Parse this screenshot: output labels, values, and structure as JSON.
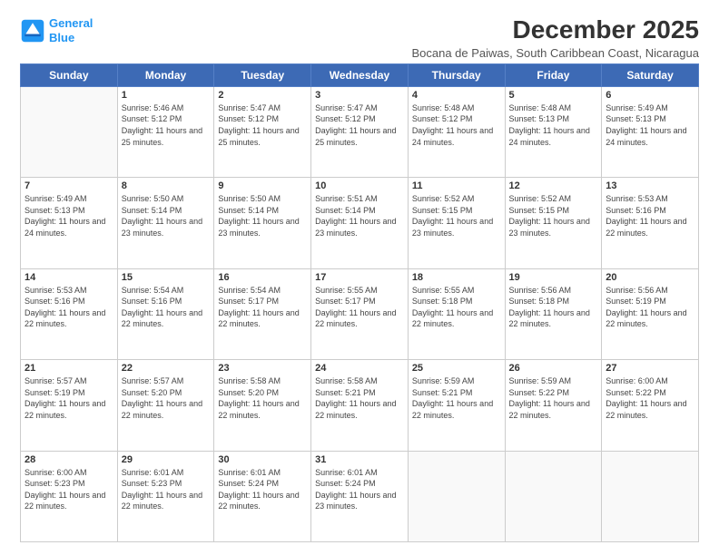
{
  "header": {
    "logo_line1": "General",
    "logo_line2": "Blue",
    "main_title": "December 2025",
    "subtitle": "Bocana de Paiwas, South Caribbean Coast, Nicaragua"
  },
  "weekdays": [
    "Sunday",
    "Monday",
    "Tuesday",
    "Wednesday",
    "Thursday",
    "Friday",
    "Saturday"
  ],
  "weeks": [
    [
      {
        "day": "",
        "sunrise": "",
        "sunset": "",
        "daylight": ""
      },
      {
        "day": "1",
        "sunrise": "Sunrise: 5:46 AM",
        "sunset": "Sunset: 5:12 PM",
        "daylight": "Daylight: 11 hours and 25 minutes."
      },
      {
        "day": "2",
        "sunrise": "Sunrise: 5:47 AM",
        "sunset": "Sunset: 5:12 PM",
        "daylight": "Daylight: 11 hours and 25 minutes."
      },
      {
        "day": "3",
        "sunrise": "Sunrise: 5:47 AM",
        "sunset": "Sunset: 5:12 PM",
        "daylight": "Daylight: 11 hours and 25 minutes."
      },
      {
        "day": "4",
        "sunrise": "Sunrise: 5:48 AM",
        "sunset": "Sunset: 5:12 PM",
        "daylight": "Daylight: 11 hours and 24 minutes."
      },
      {
        "day": "5",
        "sunrise": "Sunrise: 5:48 AM",
        "sunset": "Sunset: 5:13 PM",
        "daylight": "Daylight: 11 hours and 24 minutes."
      },
      {
        "day": "6",
        "sunrise": "Sunrise: 5:49 AM",
        "sunset": "Sunset: 5:13 PM",
        "daylight": "Daylight: 11 hours and 24 minutes."
      }
    ],
    [
      {
        "day": "7",
        "sunrise": "Sunrise: 5:49 AM",
        "sunset": "Sunset: 5:13 PM",
        "daylight": "Daylight: 11 hours and 24 minutes."
      },
      {
        "day": "8",
        "sunrise": "Sunrise: 5:50 AM",
        "sunset": "Sunset: 5:14 PM",
        "daylight": "Daylight: 11 hours and 23 minutes."
      },
      {
        "day": "9",
        "sunrise": "Sunrise: 5:50 AM",
        "sunset": "Sunset: 5:14 PM",
        "daylight": "Daylight: 11 hours and 23 minutes."
      },
      {
        "day": "10",
        "sunrise": "Sunrise: 5:51 AM",
        "sunset": "Sunset: 5:14 PM",
        "daylight": "Daylight: 11 hours and 23 minutes."
      },
      {
        "day": "11",
        "sunrise": "Sunrise: 5:52 AM",
        "sunset": "Sunset: 5:15 PM",
        "daylight": "Daylight: 11 hours and 23 minutes."
      },
      {
        "day": "12",
        "sunrise": "Sunrise: 5:52 AM",
        "sunset": "Sunset: 5:15 PM",
        "daylight": "Daylight: 11 hours and 23 minutes."
      },
      {
        "day": "13",
        "sunrise": "Sunrise: 5:53 AM",
        "sunset": "Sunset: 5:16 PM",
        "daylight": "Daylight: 11 hours and 22 minutes."
      }
    ],
    [
      {
        "day": "14",
        "sunrise": "Sunrise: 5:53 AM",
        "sunset": "Sunset: 5:16 PM",
        "daylight": "Daylight: 11 hours and 22 minutes."
      },
      {
        "day": "15",
        "sunrise": "Sunrise: 5:54 AM",
        "sunset": "Sunset: 5:16 PM",
        "daylight": "Daylight: 11 hours and 22 minutes."
      },
      {
        "day": "16",
        "sunrise": "Sunrise: 5:54 AM",
        "sunset": "Sunset: 5:17 PM",
        "daylight": "Daylight: 11 hours and 22 minutes."
      },
      {
        "day": "17",
        "sunrise": "Sunrise: 5:55 AM",
        "sunset": "Sunset: 5:17 PM",
        "daylight": "Daylight: 11 hours and 22 minutes."
      },
      {
        "day": "18",
        "sunrise": "Sunrise: 5:55 AM",
        "sunset": "Sunset: 5:18 PM",
        "daylight": "Daylight: 11 hours and 22 minutes."
      },
      {
        "day": "19",
        "sunrise": "Sunrise: 5:56 AM",
        "sunset": "Sunset: 5:18 PM",
        "daylight": "Daylight: 11 hours and 22 minutes."
      },
      {
        "day": "20",
        "sunrise": "Sunrise: 5:56 AM",
        "sunset": "Sunset: 5:19 PM",
        "daylight": "Daylight: 11 hours and 22 minutes."
      }
    ],
    [
      {
        "day": "21",
        "sunrise": "Sunrise: 5:57 AM",
        "sunset": "Sunset: 5:19 PM",
        "daylight": "Daylight: 11 hours and 22 minutes."
      },
      {
        "day": "22",
        "sunrise": "Sunrise: 5:57 AM",
        "sunset": "Sunset: 5:20 PM",
        "daylight": "Daylight: 11 hours and 22 minutes."
      },
      {
        "day": "23",
        "sunrise": "Sunrise: 5:58 AM",
        "sunset": "Sunset: 5:20 PM",
        "daylight": "Daylight: 11 hours and 22 minutes."
      },
      {
        "day": "24",
        "sunrise": "Sunrise: 5:58 AM",
        "sunset": "Sunset: 5:21 PM",
        "daylight": "Daylight: 11 hours and 22 minutes."
      },
      {
        "day": "25",
        "sunrise": "Sunrise: 5:59 AM",
        "sunset": "Sunset: 5:21 PM",
        "daylight": "Daylight: 11 hours and 22 minutes."
      },
      {
        "day": "26",
        "sunrise": "Sunrise: 5:59 AM",
        "sunset": "Sunset: 5:22 PM",
        "daylight": "Daylight: 11 hours and 22 minutes."
      },
      {
        "day": "27",
        "sunrise": "Sunrise: 6:00 AM",
        "sunset": "Sunset: 5:22 PM",
        "daylight": "Daylight: 11 hours and 22 minutes."
      }
    ],
    [
      {
        "day": "28",
        "sunrise": "Sunrise: 6:00 AM",
        "sunset": "Sunset: 5:23 PM",
        "daylight": "Daylight: 11 hours and 22 minutes."
      },
      {
        "day": "29",
        "sunrise": "Sunrise: 6:01 AM",
        "sunset": "Sunset: 5:23 PM",
        "daylight": "Daylight: 11 hours and 22 minutes."
      },
      {
        "day": "30",
        "sunrise": "Sunrise: 6:01 AM",
        "sunset": "Sunset: 5:24 PM",
        "daylight": "Daylight: 11 hours and 22 minutes."
      },
      {
        "day": "31",
        "sunrise": "Sunrise: 6:01 AM",
        "sunset": "Sunset: 5:24 PM",
        "daylight": "Daylight: 11 hours and 23 minutes."
      },
      {
        "day": "",
        "sunrise": "",
        "sunset": "",
        "daylight": ""
      },
      {
        "day": "",
        "sunrise": "",
        "sunset": "",
        "daylight": ""
      },
      {
        "day": "",
        "sunrise": "",
        "sunset": "",
        "daylight": ""
      }
    ]
  ]
}
